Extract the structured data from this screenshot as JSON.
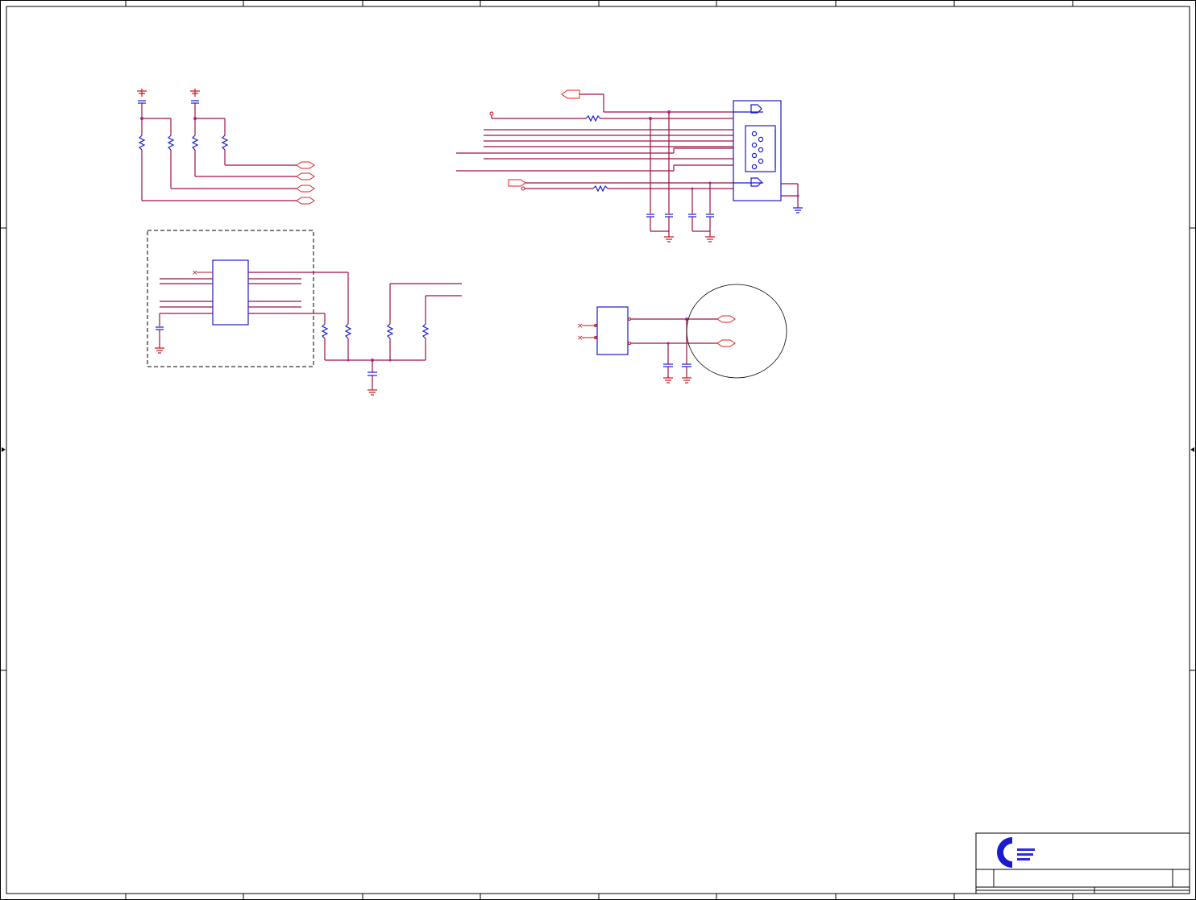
{
  "title_block": {
    "logo_icon": "company-logo-icon",
    "logo_colors": [
      "#1a1ad0",
      "#2a2ae8"
    ]
  },
  "colors": {
    "wire": "#a01040",
    "component": "#1a1ad0",
    "pin": "#c01020",
    "frame": "#000000"
  }
}
